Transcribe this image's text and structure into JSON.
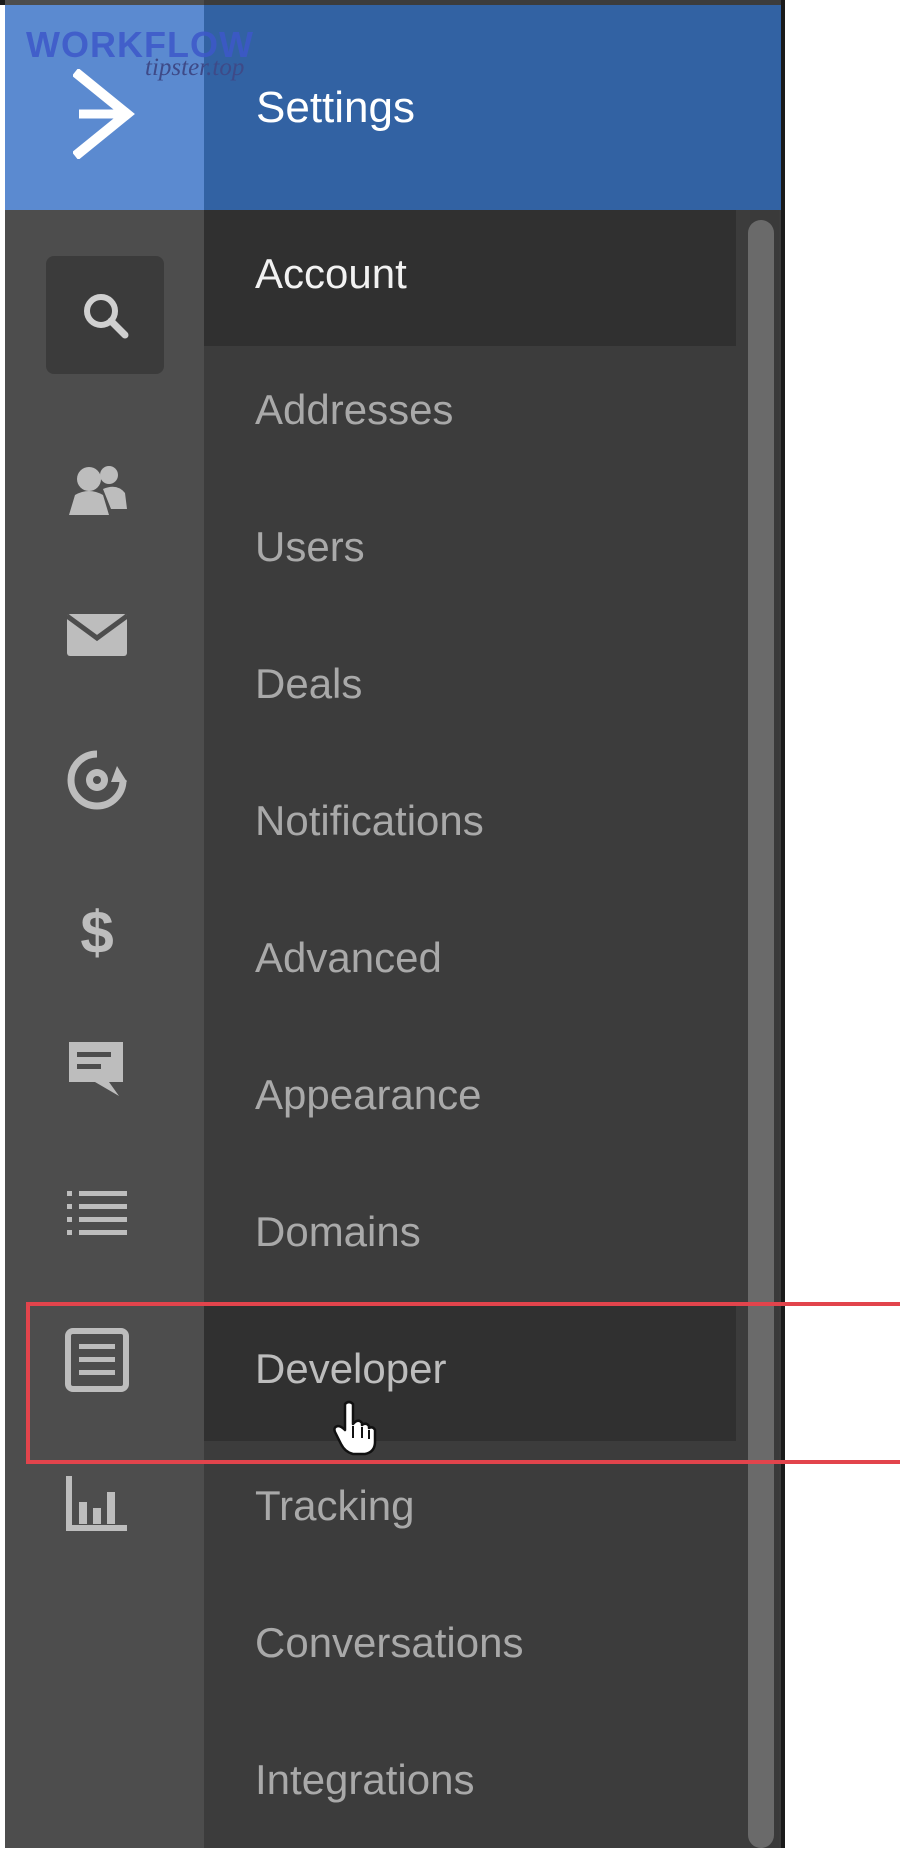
{
  "watermark": {
    "line1": "WORKFLOW",
    "line2": "tipster.top"
  },
  "header": {
    "title": "Settings"
  },
  "rail": {
    "logo_icon": "chevron-right-icon",
    "search_icon": "search-icon",
    "icons": [
      "contacts-icon",
      "email-icon",
      "automations-icon",
      "deals-icon",
      "conversations-icon",
      "lists-icon",
      "settings-page-icon",
      "reports-icon"
    ]
  },
  "menu": {
    "items": [
      {
        "label": "Account",
        "state": "active"
      },
      {
        "label": "Addresses"
      },
      {
        "label": "Users"
      },
      {
        "label": "Deals"
      },
      {
        "label": "Notifications"
      },
      {
        "label": "Advanced"
      },
      {
        "label": "Appearance"
      },
      {
        "label": "Domains"
      },
      {
        "label": "Developer",
        "state": "hover"
      },
      {
        "label": "Tracking"
      },
      {
        "label": "Conversations"
      },
      {
        "label": "Integrations"
      }
    ]
  },
  "colors": {
    "accent_logo": "#5b8ad0",
    "header_bg": "#3262a3",
    "rail_bg": "#4d4d4d",
    "menu_bg": "#3c3c3c",
    "highlight": "#e2444c"
  }
}
